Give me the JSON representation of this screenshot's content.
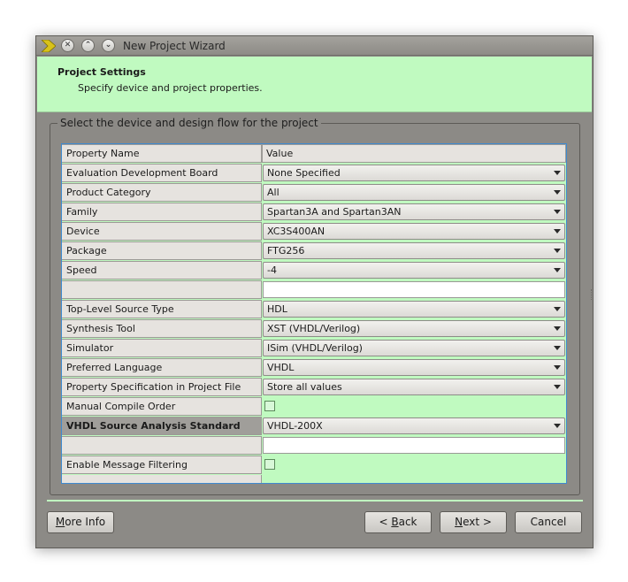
{
  "window": {
    "title": "New Project Wizard"
  },
  "header": {
    "title": "Project Settings",
    "subtitle": "Specify device and project properties."
  },
  "group": {
    "legend": "Select the device and design flow for the project"
  },
  "table": {
    "col_name": "Property Name",
    "col_value": "Value",
    "rows": [
      {
        "name": "Evaluation Development Board",
        "value": "None Specified"
      },
      {
        "name": "Product Category",
        "value": "All"
      },
      {
        "name": "Family",
        "value": "Spartan3A and Spartan3AN"
      },
      {
        "name": "Device",
        "value": "XC3S400AN"
      },
      {
        "name": "Package",
        "value": "FTG256"
      },
      {
        "name": "Speed",
        "value": "-4"
      },
      {
        "name": "",
        "value": ""
      },
      {
        "name": "Top-Level Source Type",
        "value": "HDL"
      },
      {
        "name": "Synthesis Tool",
        "value": "XST (VHDL/Verilog)"
      },
      {
        "name": "Simulator",
        "value": "ISim (VHDL/Verilog)"
      },
      {
        "name": "Preferred Language",
        "value": "VHDL"
      },
      {
        "name": "Property Specification in Project File",
        "value": "Store all values"
      },
      {
        "name": "Manual Compile Order",
        "value": ""
      },
      {
        "name": "VHDL Source Analysis Standard",
        "value": "VHDL-200X"
      },
      {
        "name": "",
        "value": ""
      },
      {
        "name": "Enable Message Filtering",
        "value": ""
      }
    ]
  },
  "buttons": {
    "more_info_prefix": "M",
    "more_info_rest": "ore Info",
    "back_prefix": "< ",
    "back_mnemonic": "B",
    "back_rest": "ack",
    "next_mnemonic": "N",
    "next_rest": "ext >",
    "cancel": "Cancel"
  }
}
